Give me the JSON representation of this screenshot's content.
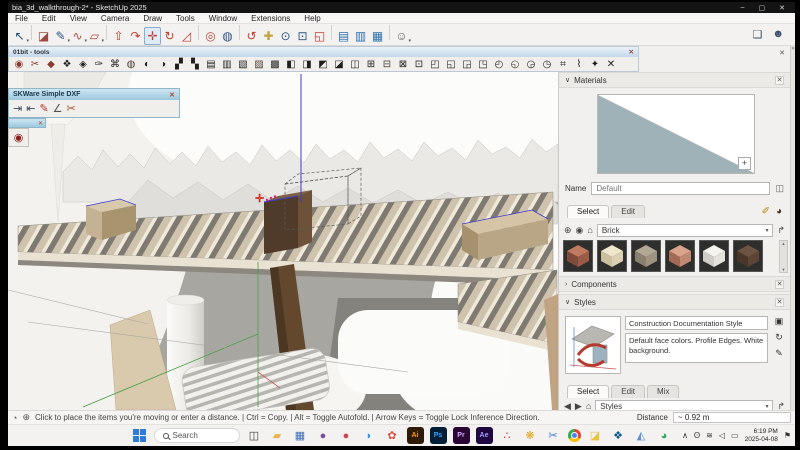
{
  "window": {
    "title": "bia_3d_walkthrough-2* - SketchUp 2025"
  },
  "icons": {
    "minimize": "–",
    "maximize": "▢",
    "close": "✕",
    "dropdown": "▾",
    "chevron_down": "∨",
    "chevron_right": "›",
    "new_document": "❏",
    "sign_in_person": "☻",
    "eyedropper": "✐",
    "paint_bucket": "◕",
    "create_material": "⊕",
    "material_gear": "◉",
    "home": "⌂",
    "detail_arrow": "↱",
    "duplicate": "◫",
    "plus": "+",
    "scroll_up": "▲",
    "scroll_down": "▼",
    "monitor": "▣",
    "refresh": "↻",
    "edit_pencil": "✎",
    "back": "◀",
    "forward": "▶",
    "geolocation": "◔",
    "crosshair": "⊕",
    "notification": "⚑"
  },
  "menu": {
    "items": [
      "File",
      "Edit",
      "View",
      "Camera",
      "Draw",
      "Tools",
      "Window",
      "Extensions",
      "Help"
    ]
  },
  "toolbar_main": {
    "groups": [
      [
        {
          "name": "select-tool-icon",
          "glyph": "↖",
          "color": "#20486e",
          "dd": true
        }
      ],
      [
        {
          "name": "eraser-tool-icon",
          "glyph": "◪",
          "color": "#9c4a3f"
        },
        {
          "name": "pencil-tool-icon",
          "glyph": "✎",
          "color": "#2d5584",
          "dd": true
        },
        {
          "name": "arc-tool-icon",
          "glyph": "∿",
          "color": "#b04a3e",
          "dd": true
        },
        {
          "name": "rectangle-tool-icon",
          "glyph": "▱",
          "color": "#b04a3e",
          "dd": true
        }
      ],
      [
        {
          "name": "pushpull-tool-icon",
          "glyph": "⇧",
          "color": "#c23b2e"
        },
        {
          "name": "followme-tool-icon",
          "glyph": "↷",
          "color": "#c23b2e"
        },
        {
          "name": "move-tool-icon",
          "glyph": "✛",
          "color": "#c23b2e",
          "active": true
        },
        {
          "name": "rotate-tool-icon",
          "glyph": "↻",
          "color": "#c23b2e"
        },
        {
          "name": "scale-tool-icon",
          "glyph": "◿",
          "color": "#c23b2e"
        }
      ],
      [
        {
          "name": "offset-tool-icon",
          "glyph": "◎",
          "color": "#b04a3e"
        },
        {
          "name": "paint-bucket-tool-icon",
          "glyph": "◍",
          "color": "#2d5584"
        }
      ],
      [
        {
          "name": "orbit-tool-icon",
          "glyph": "↺",
          "color": "#c23b2e"
        },
        {
          "name": "pan-tool-icon",
          "glyph": "✚",
          "color": "#c2a23c"
        },
        {
          "name": "zoom-tool-icon",
          "glyph": "⊙",
          "color": "#2d5584"
        },
        {
          "name": "zoom-window-icon",
          "glyph": "⊡",
          "color": "#2d5584"
        },
        {
          "name": "zoom-extents-icon",
          "glyph": "◱",
          "color": "#c23b2e"
        }
      ],
      [
        {
          "name": "section-plane-icon",
          "glyph": "▤",
          "color": "#2d6fae"
        },
        {
          "name": "section-fill-icon",
          "glyph": "▥",
          "color": "#2d6fae"
        },
        {
          "name": "section-display-icon",
          "glyph": "▦",
          "color": "#2d6fae"
        }
      ],
      [
        {
          "name": "account-icon",
          "glyph": "☺",
          "color": "#666666",
          "dd": true
        }
      ]
    ]
  },
  "plugin_toolbar": {
    "title": "01bit - tools",
    "icons": [
      "◉",
      "✂",
      "◆",
      "❖",
      "◈",
      "✑",
      "⌘",
      "◍",
      "◐",
      "◑",
      "▞",
      "▚",
      "▤",
      "▥",
      "▧",
      "▨",
      "▩",
      "◧",
      "◨",
      "◩",
      "◪",
      "◫",
      "⊞",
      "⊟",
      "⊠",
      "⊡",
      "◰",
      "◱",
      "◲",
      "◳",
      "◴",
      "◵",
      "◶",
      "◷",
      "⌗",
      "⌇",
      "✦",
      "✕"
    ]
  },
  "dxf_toolbar": {
    "title": "SKWare Simple DXF",
    "icons": [
      {
        "name": "dxf-import-icon",
        "glyph": "⇥",
        "color": "#3a4a5a"
      },
      {
        "name": "dxf-export-icon",
        "glyph": "⇤",
        "color": "#3a4a5a"
      },
      {
        "name": "red-pencil-icon",
        "glyph": "✎",
        "color": "#b03226"
      },
      {
        "name": "angle-tool-icon",
        "glyph": "∠",
        "color": "#555555"
      },
      {
        "name": "cut-material-icon",
        "glyph": "✂",
        "color": "#a8502e"
      }
    ]
  },
  "mini_toolbar": {
    "icon": "◉"
  },
  "tray": {
    "materials": {
      "title": "Materials",
      "name_label": "Name",
      "material_name": "Default",
      "tabs": [
        "Select",
        "Edit"
      ],
      "active_tab": "Select",
      "collection": "Brick",
      "swatches": [
        {
          "name": "brick-rough-red",
          "top": "#c07a62",
          "left": "#7e4a3c",
          "right": "#9c5a48"
        },
        {
          "name": "brick-cream",
          "top": "#efe6cc",
          "left": "#cbbf9f",
          "right": "#ddd0b2"
        },
        {
          "name": "brick-tan-gray",
          "top": "#b3a896",
          "left": "#8a8070",
          "right": "#9e9381"
        },
        {
          "name": "brick-pink",
          "top": "#d9a28b",
          "left": "#a56a55",
          "right": "#c08a72"
        },
        {
          "name": "brick-white",
          "top": "#f5f3ee",
          "left": "#cfcdc6",
          "right": "#e4e2db"
        },
        {
          "name": "brick-dark-brown",
          "top": "#6e5443",
          "left": "#4a3628",
          "right": "#5c4436"
        }
      ]
    },
    "components": {
      "title": "Components"
    },
    "styles": {
      "title": "Styles",
      "style_name": "Construction Documentation Style",
      "style_description": "Default face colors. Profile Edges. White background.",
      "tabs": [
        "Select",
        "Edit",
        "Mix"
      ],
      "active_tab": "Select",
      "collection": "Styles"
    }
  },
  "statusbar": {
    "hint": "Click to place the items you're moving or enter a distance.   |  Ctrl = Copy.  |  Alt = Toggle Autofold.  |  Arrow Keys = Toggle Lock Inference Direction.",
    "distance_label": "Distance",
    "distance_value": "~ 0.92 m"
  },
  "taskbar": {
    "search_placeholder": "Search",
    "apps": [
      {
        "name": "task-view",
        "glyph": "◫",
        "fg": "#3c3c3c"
      },
      {
        "name": "file-explorer",
        "glyph": "▰",
        "fg": "#e9b44c"
      },
      {
        "name": "calculator",
        "glyph": "▦",
        "fg": "#3f6fb5"
      },
      {
        "name": "app-purple",
        "glyph": "●",
        "fg": "#7c4fa0"
      },
      {
        "name": "app-red-circle",
        "glyph": "●",
        "fg": "#c34a52"
      },
      {
        "name": "vscode",
        "glyph": "◗",
        "fg": "#2f9ae0"
      },
      {
        "name": "photos-app",
        "glyph": "✿",
        "fg": "#d94f46"
      },
      {
        "name": "adobe-illustrator",
        "label": "Ai",
        "bg": "#2e1b05",
        "fg": "#ff9a00"
      },
      {
        "name": "adobe-photoshop",
        "label": "Ps",
        "bg": "#001e36",
        "fg": "#31a8ff"
      },
      {
        "name": "adobe-premiere",
        "label": "Pr",
        "bg": "#2a0634",
        "fg": "#d8a9ff"
      },
      {
        "name": "adobe-aftereffects",
        "label": "Ae",
        "bg": "#1f0740",
        "fg": "#a49bff"
      },
      {
        "name": "app-red-dots",
        "glyph": "∴",
        "fg": "#c0392b"
      },
      {
        "name": "app-pinwheel",
        "glyph": "❋",
        "fg": "#e0a517"
      },
      {
        "name": "app-caliper",
        "glyph": "✂",
        "fg": "#3b7dd8"
      },
      {
        "name": "chrome",
        "kind": "chrome"
      },
      {
        "name": "app-dark-folder",
        "glyph": "◪",
        "fg": "#e8c33c"
      },
      {
        "name": "sketchup-app",
        "glyph": "❖",
        "fg": "#0a5b8c"
      },
      {
        "name": "image-viewer",
        "glyph": "◭",
        "fg": "#5a8fd6"
      },
      {
        "name": "edge-browser",
        "glyph": "◕",
        "fg": "#35a66a"
      }
    ],
    "tray_icons": [
      {
        "name": "tray-chevron-icon",
        "glyph": "∧"
      },
      {
        "name": "microphone-icon",
        "glyph": "ʘ"
      },
      {
        "name": "wifi-icon",
        "glyph": "≋"
      },
      {
        "name": "volume-icon",
        "glyph": "◁"
      },
      {
        "name": "battery-icon",
        "glyph": "▭"
      }
    ],
    "clock_time": "6:19 PM",
    "clock_date": "2025-04-08"
  }
}
